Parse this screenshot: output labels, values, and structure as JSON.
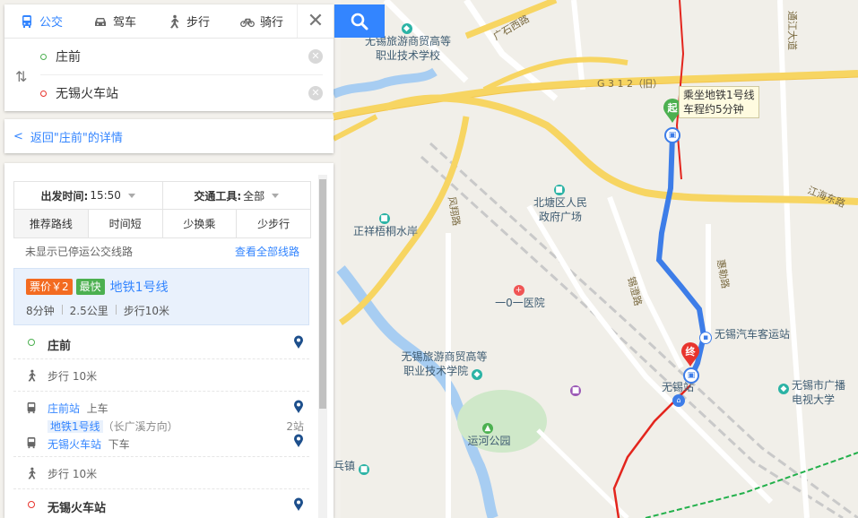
{
  "map": {
    "labels": {
      "guangshi_west": "广石西路",
      "g312": "G 3 1 2（旧）",
      "fengxiang": "风翔路",
      "xitang": "锡澄路",
      "huile": "惠勒路",
      "jianghai": "江海东路",
      "tongjiang": "通江大道",
      "school_top": "无锡旅游商贸高等\n职业技术学校",
      "beitang": "北塘区人民\n政府广场",
      "zhengxiang": "正祥梧桐水岸",
      "hospital": "一0一医院",
      "college": "无锡旅游商贸高等\n职业技术学院",
      "bus_station": "无锡汽车客运站",
      "wuxi_station": "无锡站",
      "tv_univ": "无锡市广播\n电视大学",
      "canal_park": "运河公园",
      "town": "乓镇"
    },
    "callout": "乘坐地铁1号线\n车程约5分钟",
    "start_marker": "起",
    "end_marker": "终"
  },
  "search": {
    "modes": [
      {
        "label": "公交",
        "icon": "bus-icon"
      },
      {
        "label": "驾车",
        "icon": "car-icon"
      },
      {
        "label": "步行",
        "icon": "walk-icon"
      },
      {
        "label": "骑行",
        "icon": "bicycle-icon"
      }
    ],
    "origin": "庄前",
    "destination": "无锡火车站"
  },
  "back": {
    "label": "返回\"庄前\"的详情"
  },
  "filters": {
    "depart_label": "出发时间:",
    "depart_value": "15:50",
    "vehicle_label": "交通工具:",
    "vehicle_value": "全部",
    "sorts": [
      "推荐路线",
      "时间短",
      "少换乘",
      "少步行"
    ],
    "note": "未显示已停运公交线路",
    "view_all": "查看全部线路"
  },
  "plan": {
    "price_badge": "票价￥2",
    "fast_badge": "最快",
    "line": "地铁1号线",
    "duration": "8分钟",
    "distance": "2.5公里",
    "walk": "步行10米",
    "colors": {
      "price": "#f36b21",
      "fast": "#4cb050",
      "accent": "#3385ff"
    }
  },
  "steps": {
    "start": "庄前",
    "walk1": "步行  10米",
    "board_station": "庄前站",
    "board_action": "上车",
    "line_tag": "地铁1号线",
    "direction": "（长广溪方向）",
    "stops": "2站",
    "alight_station": "无锡火车站",
    "alight_action": "下车",
    "walk2": "步行  10米",
    "end": "无锡火车站"
  }
}
